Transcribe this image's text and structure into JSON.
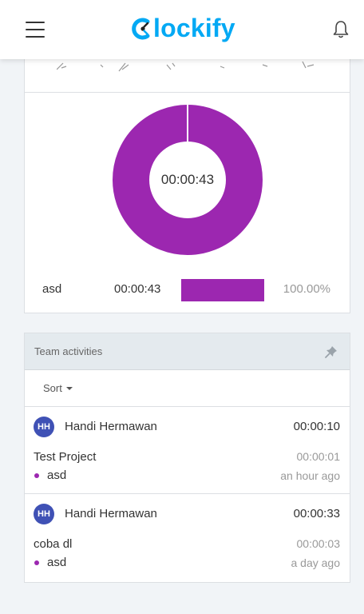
{
  "header": {
    "logo_text": "lockify",
    "brand_color": "#03a9f4",
    "menu_icon": "hamburger-menu-icon",
    "notification_icon": "bell-icon"
  },
  "report": {
    "donut_center_label": "00:00:43",
    "legend": [
      {
        "name": "asd",
        "time": "00:00:43",
        "share": 1.0,
        "percent": "100.00%",
        "color": "#9c27b0"
      }
    ]
  },
  "team_activities": {
    "title": "Team activities",
    "pin_icon": "pin-icon",
    "sort_label": "Sort",
    "items": [
      {
        "initials": "HH",
        "user": "Handi Hermawan",
        "total": "00:00:10",
        "description": "Test Project",
        "entry_time": "00:00:01",
        "project": "asd",
        "ago": "an hour ago"
      },
      {
        "initials": "HH",
        "user": "Handi Hermawan",
        "total": "00:00:33",
        "description": "coba dl",
        "entry_time": "00:00:03",
        "project": "asd",
        "ago": "a day ago"
      }
    ]
  },
  "colors": {
    "accent_purple": "#9c27b0",
    "avatar_blue": "#3f51b5",
    "page_bg": "#f1f4f7"
  }
}
